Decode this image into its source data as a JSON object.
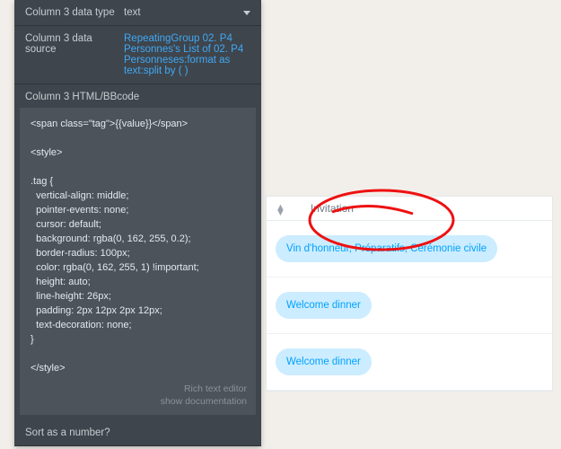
{
  "panel": {
    "dataTypeLabel": "Column 3 data type",
    "dataTypeValue": "text",
    "dataSourceLabel": "Column 3 data source",
    "dataSourceValue": "RepeatingGroup 02. P4 Personnes's List of 02. P4 Personneses:format as text:split by ( )",
    "htmlHead": "Column 3 HTML/BBcode",
    "code": "<span class=\"tag\">{{value}}</span>\n\n<style>\n\n.tag {\n  vertical-align: middle;\n  pointer-events: none;\n  cursor: default;\n  background: rgba(0, 162, 255, 0.2);\n  border-radius: 100px;\n  color: rgba(0, 162, 255, 1) !important;\n  height: auto;\n  line-height: 26px;\n  padding: 2px 12px 2px 12px;\n  text-decoration: none;\n}\n\n</style>",
    "footer1": "Rich text editor",
    "footer2": "show documentation",
    "sortLabel": "Sort as a number?"
  },
  "preview": {
    "header": "Invitation",
    "rows": [
      "Vin d'honneur, Préparatifs, Cérémonie civile",
      "Welcome dinner",
      "Welcome dinner"
    ]
  }
}
